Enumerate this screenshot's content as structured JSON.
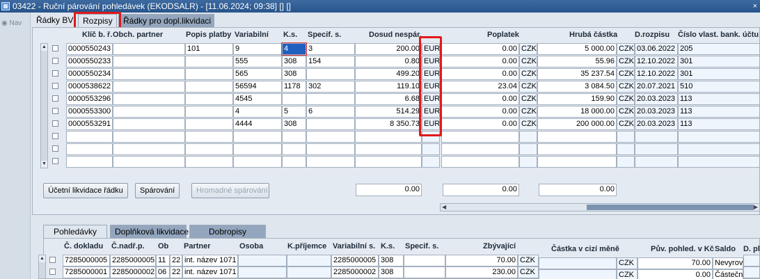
{
  "window": {
    "title": "03422 - Ruční párování pohledávek (EKODSALR) - [11.06.2024; 09:38]  [] []",
    "icon": "form-icon"
  },
  "nav": {
    "label": "Nav"
  },
  "top_tabs": [
    "Řádky BV",
    "Rozpisy",
    "Řádky pro dopl.likvidaci"
  ],
  "top_grid": {
    "headers": [
      "Klíč b. ř.",
      "Obch. partner",
      "Popis platby",
      "Variabilní",
      "K.s.",
      "Specif. s.",
      "Dosud nespár.",
      "Poplatek",
      "Hrubá částka",
      "D.rozpisu",
      "Číslo vlast. bank. účtu"
    ],
    "rows": [
      {
        "klic": "0000550243",
        "partner": "",
        "popis": "101",
        "vs": "9",
        "ks": "4",
        "ss": "3",
        "nespar": "200.00",
        "mena1": "EUR",
        "poplatek": "0.00",
        "mena2": "CZK",
        "hruba": "5 000.00",
        "mena3": "CZK",
        "datum": "03.06.2022",
        "ucet": "205"
      },
      {
        "klic": "0000550233",
        "partner": "",
        "popis": "",
        "vs": "555",
        "ks": "308",
        "ss": "154",
        "nespar": "0.80",
        "mena1": "EUR",
        "poplatek": "0.00",
        "mena2": "CZK",
        "hruba": "55.96",
        "mena3": "CZK",
        "datum": "12.10.2022",
        "ucet": "301"
      },
      {
        "klic": "0000550234",
        "partner": "",
        "popis": "",
        "vs": "565",
        "ks": "308",
        "ss": "",
        "nespar": "499.20",
        "mena1": "EUR",
        "poplatek": "0.00",
        "mena2": "CZK",
        "hruba": "35 237.54",
        "mena3": "CZK",
        "datum": "12.10.2022",
        "ucet": "301"
      },
      {
        "klic": "0000538622",
        "partner": "",
        "popis": "",
        "vs": "56594",
        "ks": "1178",
        "ss": "302",
        "nespar": "119.10",
        "mena1": "EUR",
        "poplatek": "23.04",
        "mena2": "CZK",
        "hruba": "3 084.50",
        "mena3": "CZK",
        "datum": "20.07.2021",
        "ucet": "510"
      },
      {
        "klic": "0000553296",
        "partner": "",
        "popis": "",
        "vs": "4545",
        "ks": "",
        "ss": "",
        "nespar": "6.68",
        "mena1": "EUR",
        "poplatek": "0.00",
        "mena2": "CZK",
        "hruba": "159.90",
        "mena3": "CZK",
        "datum": "20.03.2023",
        "ucet": "113"
      },
      {
        "klic": "0000553300",
        "partner": "",
        "popis": "",
        "vs": "4",
        "ks": "5",
        "ss": "6",
        "nespar": "514.29",
        "mena1": "EUR",
        "poplatek": "0.00",
        "mena2": "CZK",
        "hruba": "18 000.00",
        "mena3": "CZK",
        "datum": "20.03.2023",
        "ucet": "113"
      },
      {
        "klic": "0000553291",
        "partner": "",
        "popis": "",
        "vs": "4444",
        "ks": "308",
        "ss": "",
        "nespar": "8 350.73",
        "mena1": "EUR",
        "poplatek": "0.00",
        "mena2": "CZK",
        "hruba": "200 000.00",
        "mena3": "CZK",
        "datum": "20.03.2023",
        "ucet": "113"
      }
    ],
    "empty_rows": 3
  },
  "actions": {
    "ucetni": "Účetní likvidace řádku",
    "sparovani": "Spárování",
    "hromadne": "Hromadné spárování"
  },
  "totals": {
    "nespar": "0.00",
    "poplatek": "0.00",
    "hruba": "0.00"
  },
  "bottom_tabs": [
    "Pohledávky",
    "Doplňková likvidace",
    "Dobropisy"
  ],
  "bottom_grid": {
    "headers": [
      "Č. dokladu",
      "Č.nadř.p.",
      "Ob",
      "Partner",
      "Osoba",
      "K.příjemce",
      "Variabilní s.",
      "K.s.",
      "Specif. s.",
      "Zbývající",
      "Částka v cizí měně",
      "Pův. pohled. v Kč",
      "Saldo",
      "D. pl"
    ],
    "rows": [
      {
        "doklad": "7285000005",
        "nadr": "2285000005",
        "ob1": "11",
        "ob2": "22",
        "partner": "int. název 1071",
        "osoba": "",
        "prijemce": "",
        "vs": "2285000005",
        "ks": "308",
        "ss": "",
        "zbyva": "70.00",
        "mena": "CZK",
        "cizi": "",
        "mena2": "CZK",
        "puv": "70.00",
        "saldo": "Nevyrovn"
      },
      {
        "doklad": "7285000001",
        "nadr": "2285000002",
        "ob1": "06",
        "ob2": "22",
        "partner": "int. název 1071",
        "osoba": "",
        "prijemce": "",
        "vs": "2285000002",
        "ks": "308",
        "ss": "",
        "zbyva": "230.00",
        "mena": "CZK",
        "cizi": "",
        "mena2": "CZK",
        "puv": "0.00",
        "saldo": "Částečně"
      }
    ]
  },
  "colors": {
    "highlight": "#e0191b",
    "selection": "#1f5fbf",
    "title_bar": "#2f5c93"
  }
}
